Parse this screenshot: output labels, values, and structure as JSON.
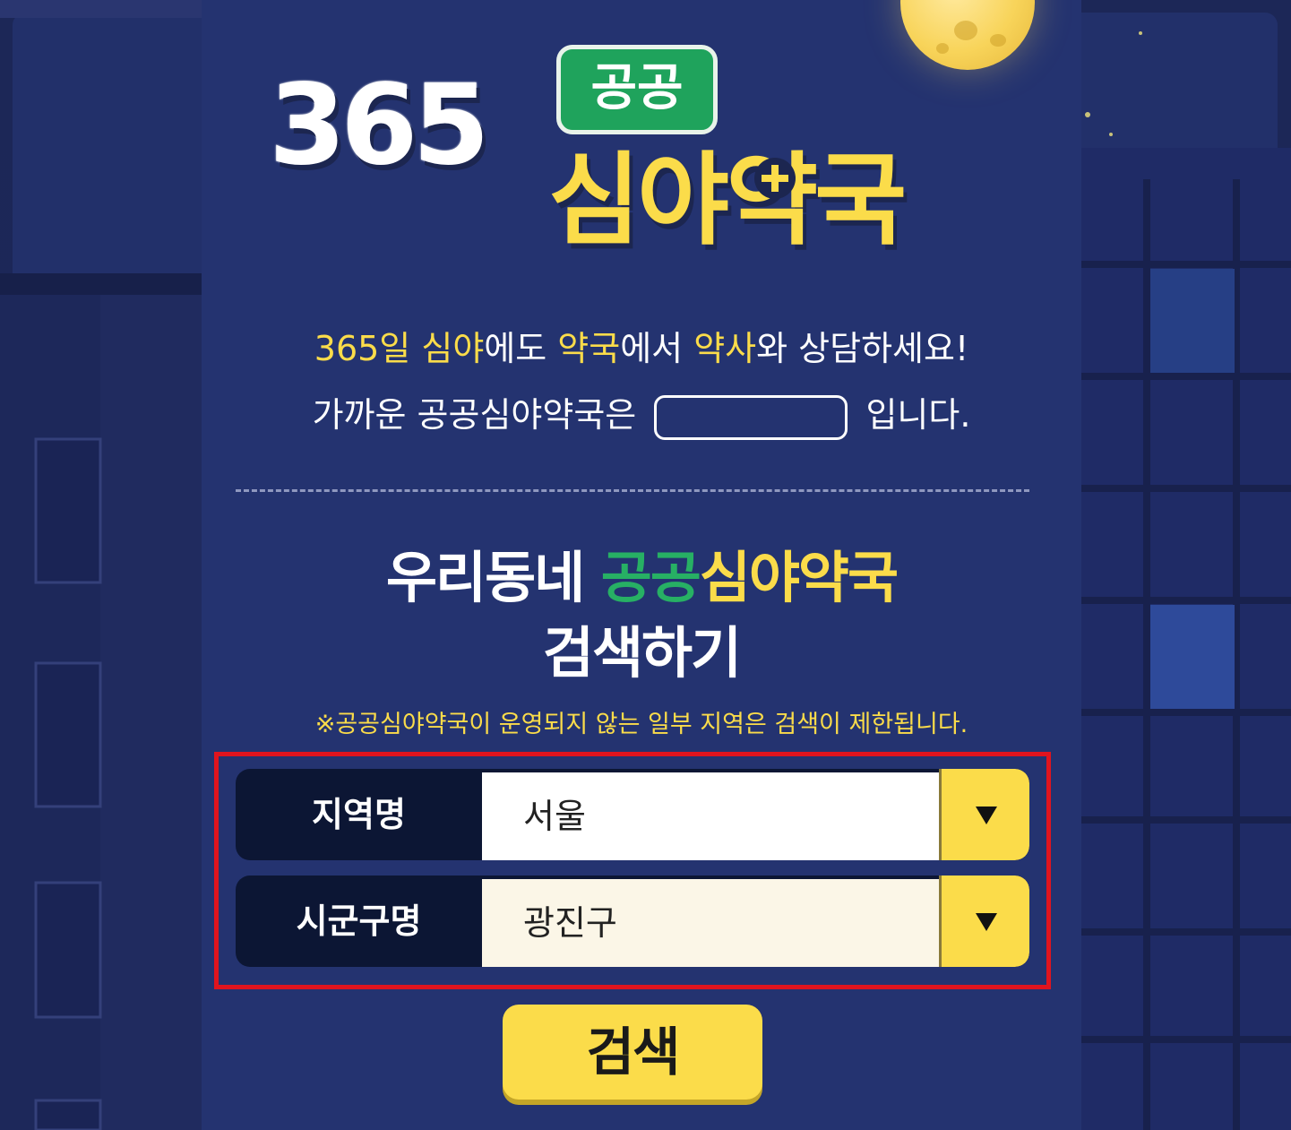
{
  "logo": {
    "number": "365",
    "badge": "공공",
    "title": "심야약국"
  },
  "intro": {
    "line1_parts": [
      "365일 ",
      "심야",
      "에도 ",
      "약국",
      "에서 ",
      "약사",
      "와 상담하세요!"
    ],
    "line2_prefix": "가까운 공공심야약국은",
    "line2_suffix": "입니다."
  },
  "search_heading": {
    "part1": "우리동네 ",
    "part2": "공공",
    "part3": "심야약국",
    "line2": "검색하기"
  },
  "notice": "※공공심야약국이 운영되지 않는 일부 지역은 검색이 제한됩니다.",
  "form": {
    "region_label": "지역명",
    "region_value": "서울",
    "district_label": "시군구명",
    "district_value": "광진구"
  },
  "search_button": "검색",
  "colors": {
    "background": "#243370",
    "accent_yellow": "#fbdc4a",
    "accent_green": "#27b064",
    "highlight_border": "#e0141e"
  }
}
